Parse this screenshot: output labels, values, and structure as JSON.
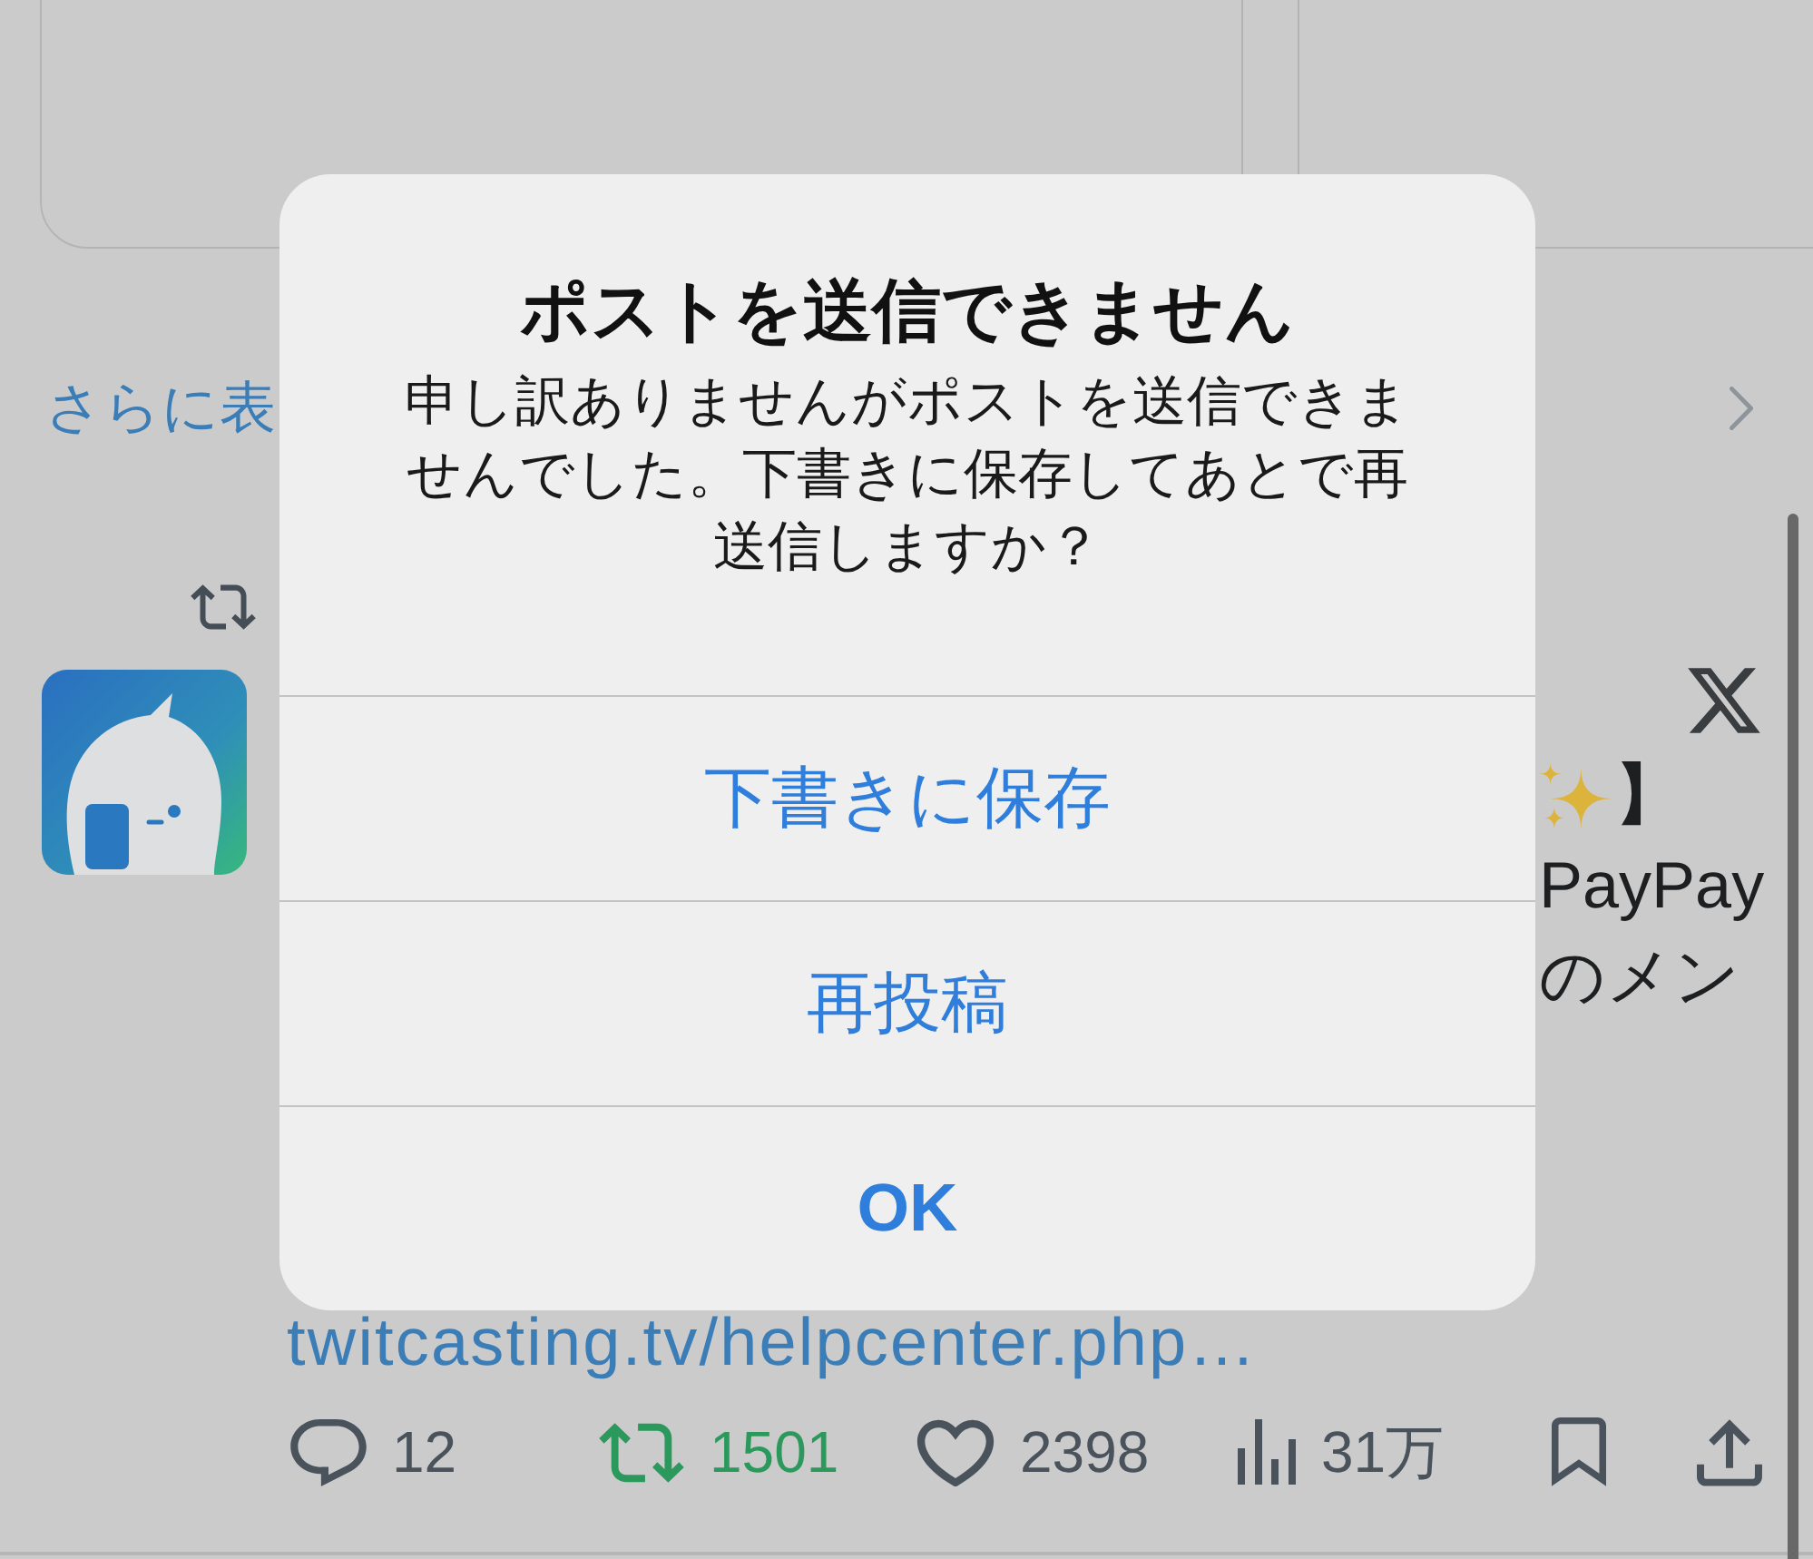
{
  "feed": {
    "show_more": {
      "label": "さらに表"
    },
    "post": {
      "lines": [
        {
          "text": "】",
          "sparkle": true
        },
        {
          "text": "PayPay",
          "sparkle": false
        },
        {
          "text": "のメン",
          "sparkle": false
        }
      ],
      "link": "twitcasting.tv/helpcenter.php…",
      "actions": [
        {
          "kind": "reply",
          "count": "12",
          "on": false
        },
        {
          "kind": "repost",
          "count": "1501",
          "on": true
        },
        {
          "kind": "like",
          "count": "2398",
          "on": false
        },
        {
          "kind": "views",
          "count": "31万",
          "on": false
        },
        {
          "kind": "bookmark",
          "on": false
        },
        {
          "kind": "share",
          "on": false
        }
      ]
    }
  },
  "alert": {
    "title": "ポストを送信できません",
    "message": "申し訳ありませんがポストを送信できませんでした。下書きに保存してあとで再送信しますか？",
    "buttons": [
      {
        "label": "下書きに保存",
        "bold": false
      },
      {
        "label": "再投稿",
        "bold": false
      },
      {
        "label": "OK",
        "bold": true
      }
    ]
  }
}
